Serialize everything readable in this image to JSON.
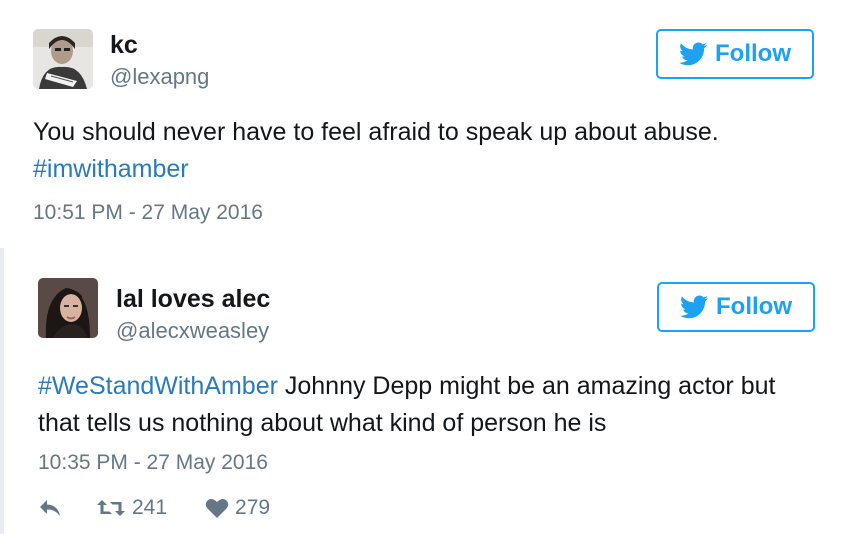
{
  "tweets": [
    {
      "name": "kc",
      "handle": "@lexapng",
      "follow_label": "Follow",
      "text_line1": "You should never have to feel afraid to speak up about abuse.",
      "hashtag": "#imwithamber",
      "time": "10:51 PM - 27 May 2016"
    },
    {
      "name": "lal loves alec",
      "handle": "@alecxweasley",
      "follow_label": "Follow",
      "hashtag": "#WeStandWithAmber",
      "text_rest": " Johnny Depp might be an amazing actor but that tells us nothing about what kind of person he is",
      "time": "10:35 PM - 27 May 2016",
      "retweets": "241",
      "likes": "279"
    }
  ],
  "icons": {
    "bird": "twitter-bird-icon",
    "reply": "reply-icon",
    "retweet": "retweet-icon",
    "like": "heart-icon"
  },
  "colors": {
    "accent": "#1da1f2",
    "hashtag": "#2b7bb9",
    "muted": "#657786",
    "text": "#14171a"
  }
}
